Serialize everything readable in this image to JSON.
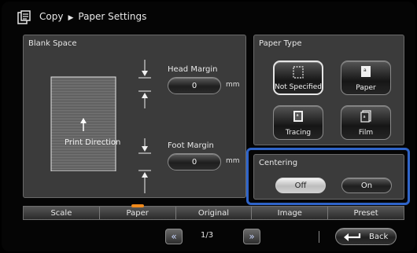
{
  "header": {
    "app": "Copy",
    "section": "Paper Settings"
  },
  "blank_space": {
    "title": "Blank Space",
    "diagram_label": "Print Direction",
    "head_margin": {
      "label": "Head Margin",
      "value": "0",
      "unit": "mm"
    },
    "foot_margin": {
      "label": "Foot Margin",
      "value": "0",
      "unit": "mm"
    }
  },
  "paper_type": {
    "title": "Paper Type",
    "options": [
      {
        "label": "Not Specified",
        "icon": "blank-sheet-icon",
        "selected": true
      },
      {
        "label": "Paper",
        "icon": "paper-sheet-icon",
        "selected": false
      },
      {
        "label": "Tracing",
        "icon": "tracing-sheet-icon",
        "selected": false
      },
      {
        "label": "Film",
        "icon": "film-sheet-icon",
        "selected": false
      }
    ]
  },
  "centering": {
    "title": "Centering",
    "options": [
      {
        "label": "Off",
        "selected": true
      },
      {
        "label": "On",
        "selected": false
      }
    ]
  },
  "tabs": [
    {
      "label": "Scale",
      "active": false
    },
    {
      "label": "Paper",
      "active": true
    },
    {
      "label": "Original",
      "active": false
    },
    {
      "label": "Image",
      "active": false
    },
    {
      "label": "Preset",
      "active": false
    }
  ],
  "pager": {
    "page": "1/3",
    "prev_icon": "double-chevron-left-icon",
    "next_icon": "double-chevron-right-icon"
  },
  "back": {
    "label": "Back",
    "icon": "return-arrow-icon"
  },
  "colors": {
    "highlight": "#2f64c9",
    "active_tab": "#f08a1c",
    "panel": "#3b3b3b"
  }
}
